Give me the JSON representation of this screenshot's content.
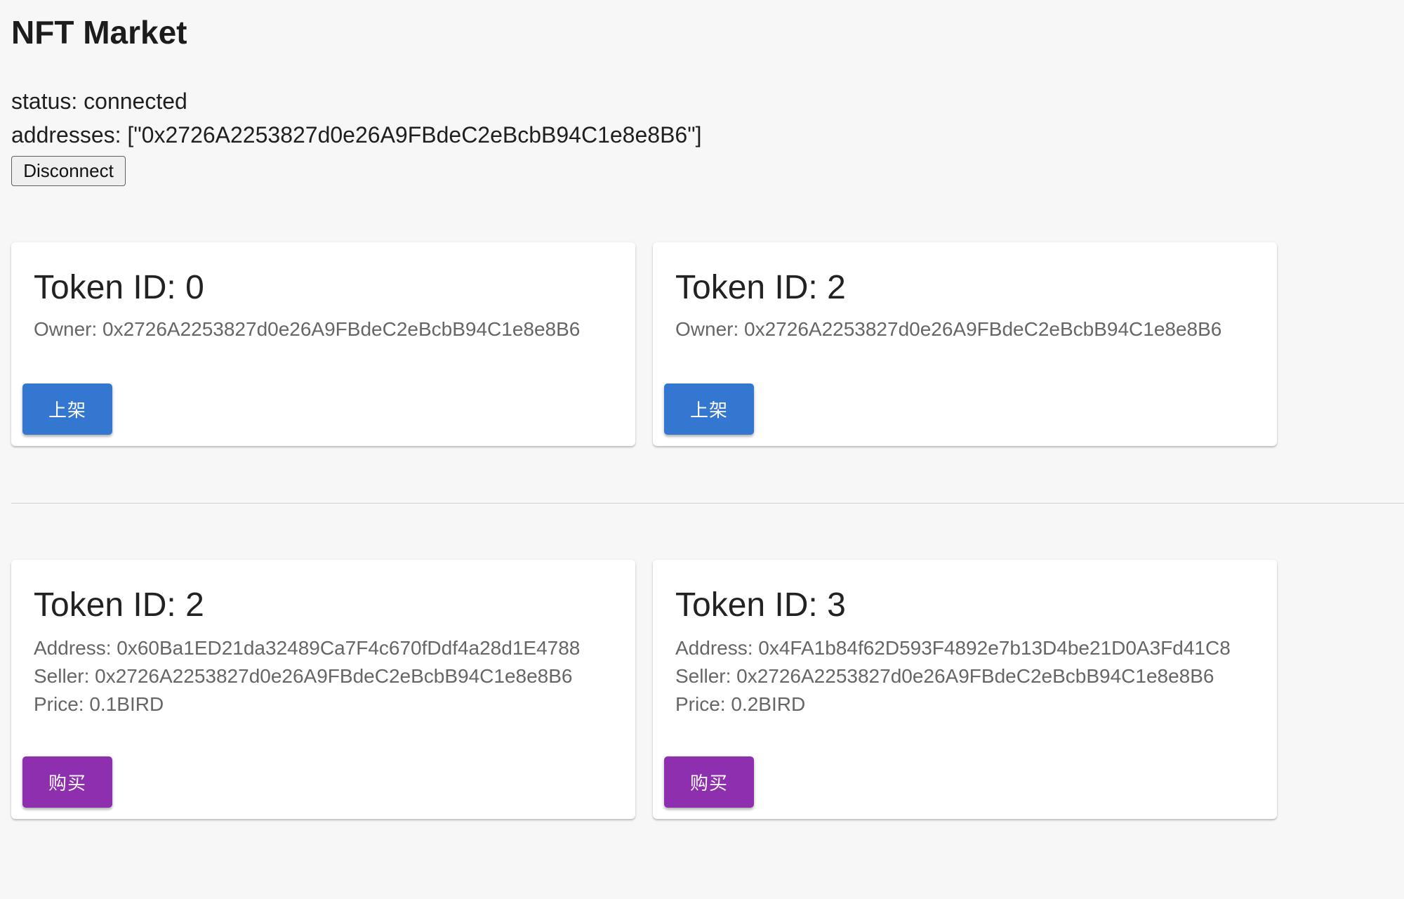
{
  "page": {
    "title": "NFT Market",
    "status_text": "status: connected",
    "addresses_text": "addresses: [\"0x2726A2253827d0e26A9FBdeC2eBcbB94C1e8e8B6\"]",
    "disconnect_label": "Disconnect"
  },
  "owned_tokens": [
    {
      "title": "Token ID: 0",
      "owner": "Owner: 0x2726A2253827d0e26A9FBdeC2eBcbB94C1e8e8B6",
      "button_label": "上架"
    },
    {
      "title": "Token ID: 2",
      "owner": "Owner: 0x2726A2253827d0e26A9FBdeC2eBcbB94C1e8e8B6",
      "button_label": "上架"
    }
  ],
  "listings": [
    {
      "title": "Token ID: 2",
      "address": "Address: 0x60Ba1ED21da32489Ca7F4c670fDdf4a28d1E4788",
      "seller": "Seller: 0x2726A2253827d0e26A9FBdeC2eBcbB94C1e8e8B6",
      "price": "Price: 0.1BIRD",
      "button_label": "购买"
    },
    {
      "title": "Token ID: 3",
      "address": "Address: 0x4FA1b84f62D593F4892e7b13D4be21D0A3Fd41C8",
      "seller": "Seller: 0x2726A2253827d0e26A9FBdeC2eBcbB94C1e8e8B6",
      "price": "Price: 0.2BIRD",
      "button_label": "购买"
    }
  ],
  "colors": {
    "list_button": "#3377d0",
    "buy_button": "#8d2fae",
    "background": "#f7f7f7"
  }
}
